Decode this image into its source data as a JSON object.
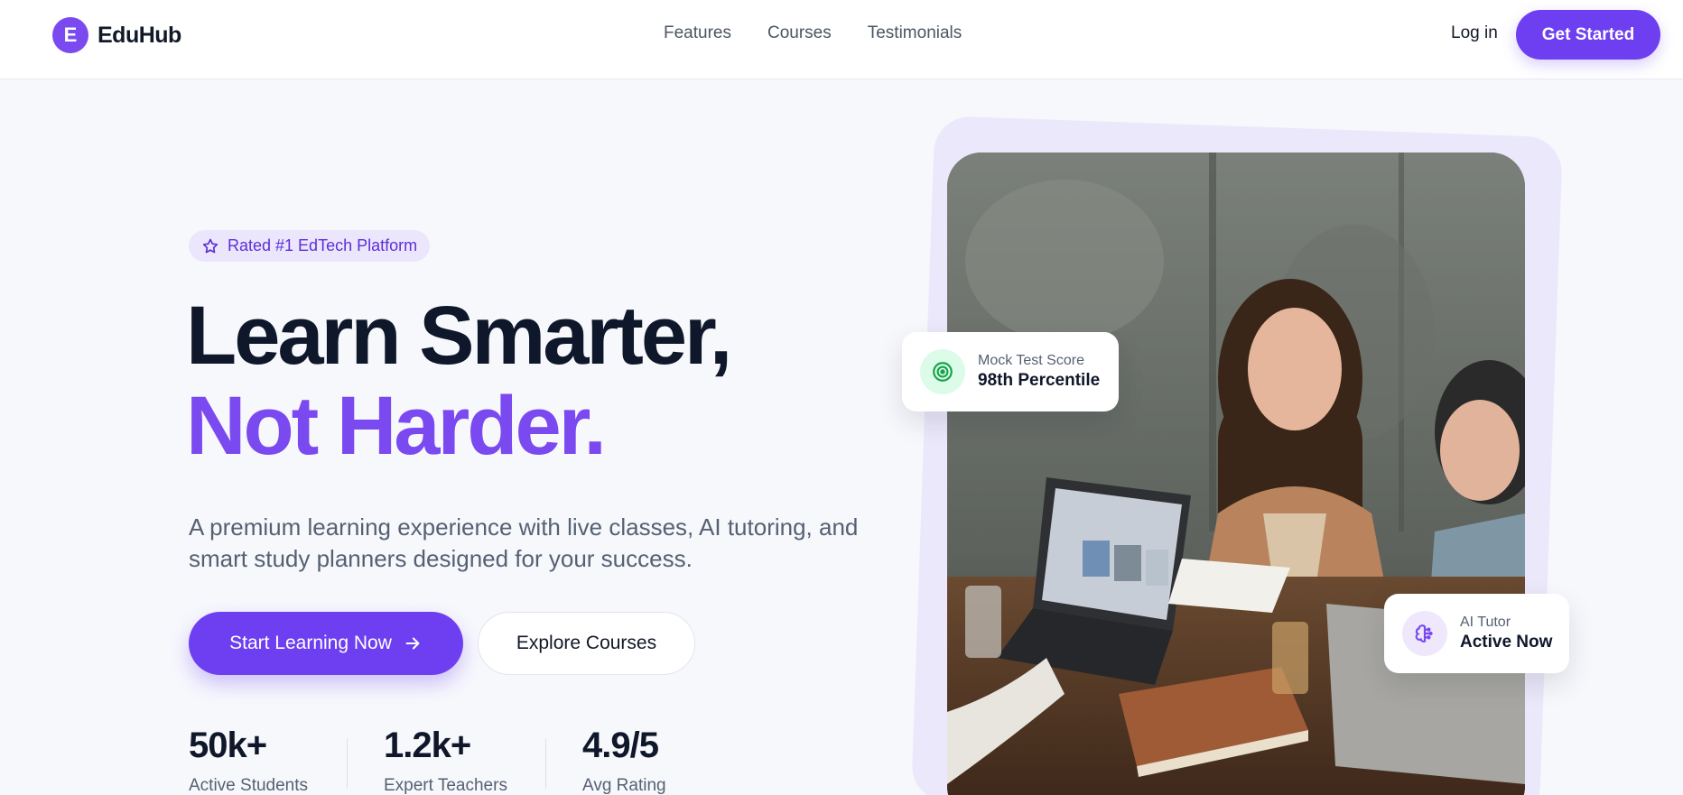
{
  "header": {
    "logo_letter": "E",
    "brand": "EduHub",
    "nav": [
      "Features",
      "Courses",
      "Testimonials"
    ],
    "login": "Log in",
    "get_started": "Get Started"
  },
  "hero": {
    "badge": "Rated #1 EdTech Platform",
    "title_line1": "Learn Smarter,",
    "title_line2": "Not Harder.",
    "subtitle": "A premium learning experience with live classes, AI tutoring, and smart study planners designed for your success.",
    "primary_button": "Start Learning Now",
    "secondary_button": "Explore Courses",
    "stats": [
      {
        "value": "50k+",
        "label": "Active Students"
      },
      {
        "value": "1.2k+",
        "label": "Expert Teachers"
      },
      {
        "value": "4.9/5",
        "label": "Avg Rating"
      }
    ]
  },
  "cards": {
    "mock_test": {
      "label": "Mock Test Score",
      "value": "98th Percentile",
      "icon": "target-icon"
    },
    "ai_tutor": {
      "label": "AI Tutor",
      "value": "Active Now",
      "icon": "brain-icon"
    }
  },
  "colors": {
    "accent": "#7a4af0",
    "accent_dark": "#6d3ff0",
    "success_bg": "#dcfbe8"
  }
}
